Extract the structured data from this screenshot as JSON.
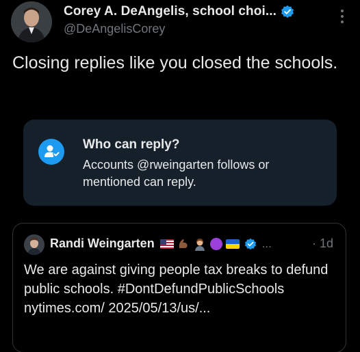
{
  "tweet": {
    "author": {
      "display_name": "Corey A. DeAngelis, school choi...",
      "handle": "@DeAngelisCorey",
      "verified": true,
      "avatar_icon": "person-avatar"
    },
    "text": "Closing replies like you closed the schools.",
    "more_icon": "more-vertical-icon"
  },
  "reply_restriction": {
    "title": "Who can reply?",
    "description": "Accounts @rweingarten follows or mentioned can reply.",
    "icon": "person-check-icon",
    "icon_color": "#1d9bf0",
    "card_color": "#16202b"
  },
  "quoted_tweet": {
    "author": {
      "display_name": "Randi Weingarten",
      "emojis": [
        "us-flag",
        "flexed-biceps",
        "teacher",
        "purple-circle",
        "ukraine-flag"
      ],
      "verified": true,
      "ellipsis": "...",
      "avatar_icon": "person-avatar"
    },
    "time": "· 1d",
    "text": "We are against giving people tax breaks to defund public schools. #DontDefundPublicSchools nytimes.com/ 2025/05/13/us/..."
  },
  "colors": {
    "background": "#000000",
    "text_primary": "#e7e9ea",
    "text_secondary": "#71767b",
    "accent": "#1d9bf0",
    "border": "#2f3336"
  }
}
